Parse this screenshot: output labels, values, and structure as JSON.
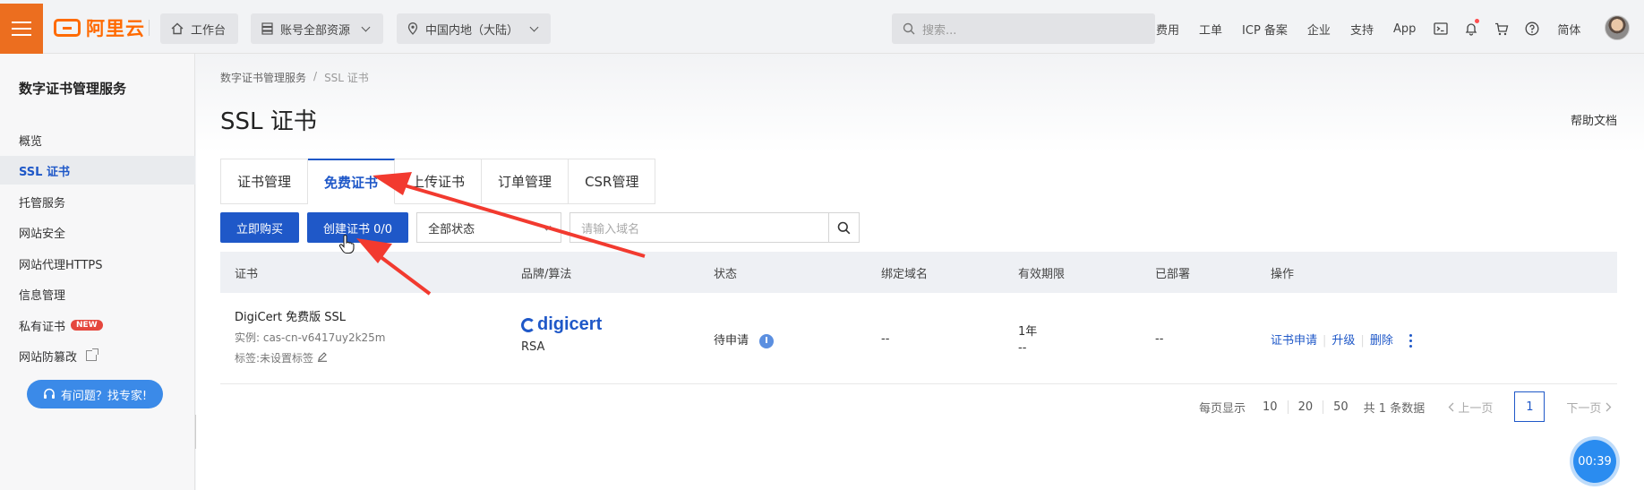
{
  "topbar": {
    "logo_text": "阿里云",
    "workbench": "工作台",
    "resources": "账号全部资源",
    "region": "中国内地（大陆）",
    "search_placeholder": "搜索...",
    "links": [
      "费用",
      "工单",
      "ICP 备案",
      "企业",
      "支持",
      "App"
    ],
    "lang": "简体"
  },
  "sidebar": {
    "title": "数字证书管理服务",
    "items": [
      {
        "label": "概览"
      },
      {
        "label": "SSL 证书"
      },
      {
        "label": "托管服务"
      },
      {
        "label": "网站安全"
      },
      {
        "label": "网站代理HTTPS"
      },
      {
        "label": "信息管理"
      },
      {
        "label": "私有证书",
        "badge": "NEW"
      },
      {
        "label": "网站防篡改"
      }
    ],
    "help_button": "有问题？找专家!"
  },
  "breadcrumb": {
    "parent": "数字证书管理服务",
    "sep": "/",
    "current": "SSL 证书"
  },
  "page": {
    "title": "SSL 证书",
    "help_doc": "帮助文档"
  },
  "tabs": [
    "证书管理",
    "免费证书",
    "上传证书",
    "订单管理",
    "CSR管理"
  ],
  "toolbar": {
    "buy": "立即购买",
    "create": "创建证书 0/0",
    "status_select": "全部状态",
    "domain_placeholder": "请输入域名"
  },
  "table": {
    "headers": [
      "证书",
      "品牌/算法",
      "状态",
      "绑定域名",
      "有效期限",
      "已部署",
      "操作"
    ],
    "row": {
      "name": "DigiCert 免费版 SSL",
      "instance": "实例: cas-cn-v6417uy2k25m",
      "tags": "标签:未设置标签",
      "brand": "digicert",
      "algorithm": "RSA",
      "status": "待申请",
      "domain": "--",
      "validity": "1年",
      "validity_sub": "--",
      "deployed": "--",
      "ops": [
        "证书申请",
        "升级",
        "删除"
      ]
    }
  },
  "pager": {
    "per_page_label": "每页显示",
    "sizes": [
      "10",
      "20",
      "50"
    ],
    "total": "共 1 条数据",
    "prev": "上一页",
    "current": "1",
    "next": "下一页"
  },
  "timer": "00:39",
  "colors": {
    "brand_orange": "#ff6a00",
    "primary_blue": "#1f58c8",
    "arrow_red": "#f23a2f"
  }
}
